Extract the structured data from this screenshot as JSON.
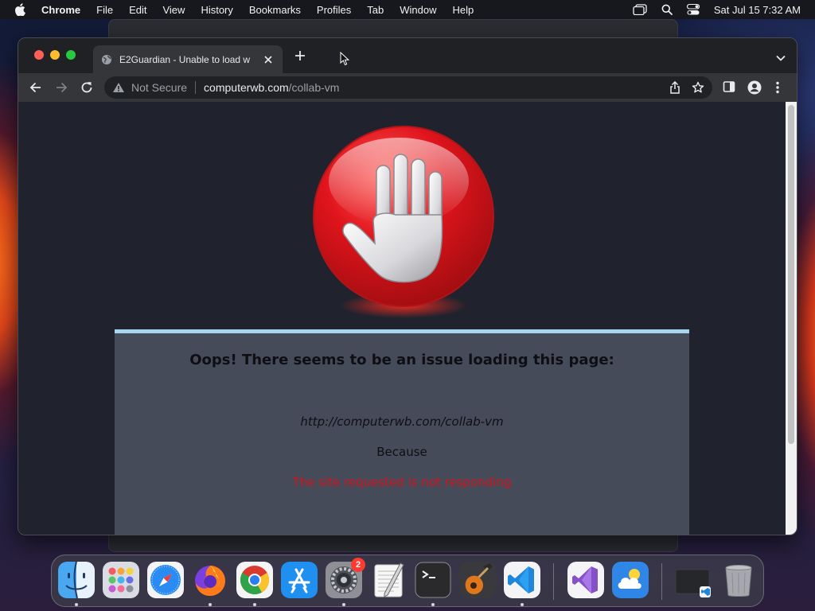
{
  "menubar": {
    "app_name": "Chrome",
    "items": [
      "File",
      "Edit",
      "View",
      "History",
      "Bookmarks",
      "Profiles",
      "Tab",
      "Window",
      "Help"
    ],
    "clock": "Sat Jul 15  7:32 AM"
  },
  "tab": {
    "title": "E2Guardian - Unable to load w",
    "favicon": "globe-icon"
  },
  "omnibox": {
    "security_label": "Not Secure",
    "host": "computerwb.com",
    "path": "/collab-vm"
  },
  "page": {
    "heading": "Oops! There seems to be an issue loading this page:",
    "blocked_url": "http://computerwb.com/collab-vm",
    "because_label": "Because",
    "reason": "The site requested is not responding",
    "colors": {
      "panel_bg": "#464b5a",
      "panel_border": "#a8d4f4",
      "reason_text": "#d7101a",
      "stop_sign": "#e0141c"
    }
  },
  "dock": {
    "apps": [
      "Finder",
      "Launchpad",
      "Safari",
      "Firefox",
      "Google Chrome",
      "App Store",
      "System Settings",
      "TextEdit",
      "Terminal",
      "GarageBand",
      "Visual Studio Code",
      "Visual Studio",
      "Weather",
      "Minimized Window",
      "Trash"
    ],
    "settings_badge": "2"
  }
}
